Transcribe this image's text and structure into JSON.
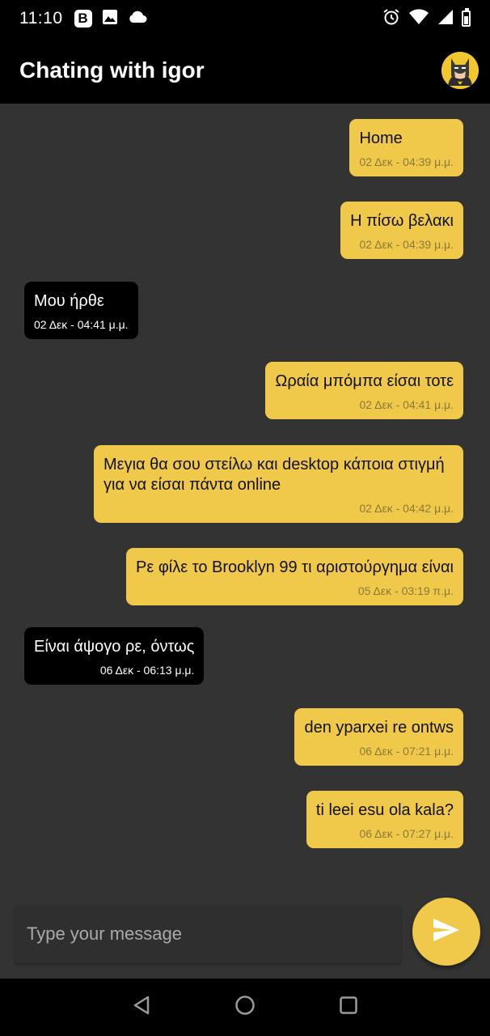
{
  "status_bar": {
    "time": "11:10",
    "left_icons": [
      "b-app-icon",
      "image-icon",
      "cloud-icon"
    ],
    "right_icons": [
      "alarm-icon",
      "wifi-icon",
      "signal-icon",
      "battery-icon"
    ]
  },
  "header": {
    "title": "Chating with igor",
    "avatar": "batman-avatar"
  },
  "messages": [
    {
      "direction": "out",
      "text": "Home",
      "time": "02 Δεκ - 04:39 μ.μ."
    },
    {
      "direction": "out",
      "text": "Η πίσω βελακι",
      "time": "02 Δεκ - 04:39 μ.μ."
    },
    {
      "direction": "in",
      "text": "Μου ήρθε",
      "time": "02 Δεκ - 04:41 μ.μ."
    },
    {
      "direction": "out",
      "text": "Ωραία μπόμπα είσαι τοτε",
      "time": "02 Δεκ - 04:41 μ.μ."
    },
    {
      "direction": "out",
      "text": "Μεγια θα σου στείλω και desktop κάποια στιγμή για να είσαι πάντα online",
      "time": "02 Δεκ - 04:42 μ.μ."
    },
    {
      "direction": "out",
      "text": "Ρε φίλε το Brooklyn 99 τι αριστούργημα είναι",
      "time": "05 Δεκ - 03:19 π.μ."
    },
    {
      "direction": "in",
      "text": "Είναι άψογο ρε, όντως",
      "time": "06 Δεκ - 06:13 μ.μ."
    },
    {
      "direction": "out",
      "text": "den yparxei re ontws",
      "time": "06 Δεκ - 07:21 μ.μ."
    },
    {
      "direction": "out",
      "text": "ti leei esu ola kala?",
      "time": "06 Δεκ - 07:27 μ.μ."
    }
  ],
  "composer": {
    "placeholder": "Type your message",
    "value": "",
    "send_icon": "send-icon"
  },
  "nav_bar": {
    "buttons": [
      "back-icon",
      "home-icon",
      "recents-icon"
    ]
  },
  "colors": {
    "accent": "#f0c94a",
    "background": "#333333",
    "bar": "#000000",
    "incoming_bubble": "#000000"
  }
}
